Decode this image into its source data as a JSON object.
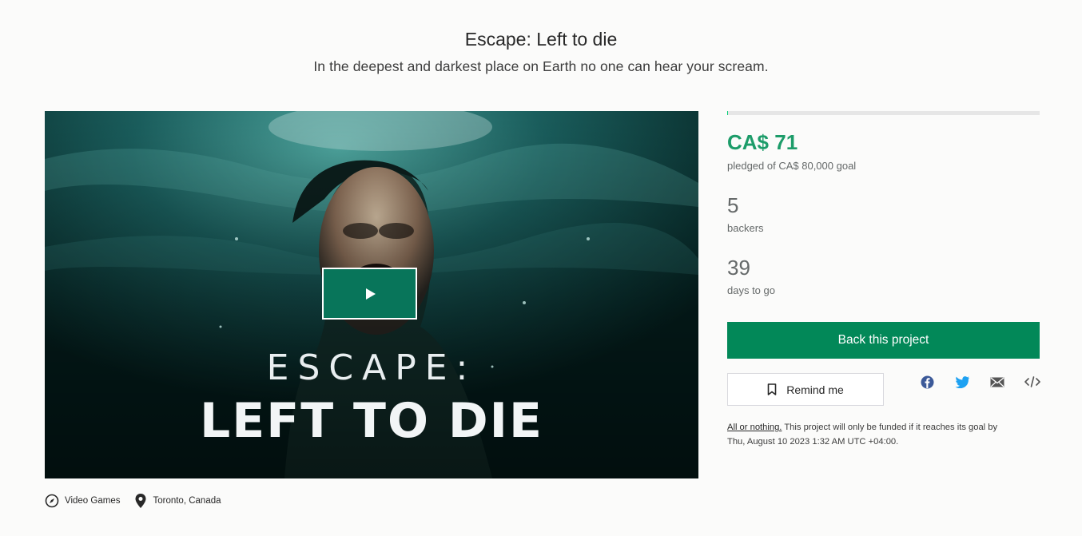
{
  "project": {
    "title": "Escape: Left to die",
    "blurb": "In the deepest and darkest place on Earth no one can hear your scream."
  },
  "video": {
    "artwork_line1": "ESCAPE:",
    "artwork_line2": "LEFT TO DIE",
    "play_icon": "play-icon"
  },
  "meta": {
    "category": "Video Games",
    "category_icon": "compass-icon",
    "location": "Toronto, Canada",
    "location_icon": "map-pin-icon"
  },
  "stats": {
    "progress_fraction": 0.001,
    "pledged": "CA$ 71",
    "pledged_label": "pledged of CA$ 80,000 goal",
    "backers": "5",
    "backers_label": "backers",
    "days": "39",
    "days_label": "days to go"
  },
  "actions": {
    "back_label": "Back this project",
    "remind_label": "Remind me",
    "remind_icon": "bookmark-icon",
    "share_icons": [
      "facebook-icon",
      "twitter-icon",
      "email-icon",
      "embed-icon"
    ]
  },
  "funding": {
    "link_text": "All or nothing.",
    "text": " This project will only be funded if it reaches its goal by",
    "deadline": "Thu, August 10 2023 1:32 AM UTC +04:00."
  },
  "colors": {
    "accent_green": "#028858",
    "pledged_green": "#1c9c69",
    "progress_fill": "#05ce78",
    "facebook": "#3b5998",
    "twitter": "#1da1f2"
  }
}
